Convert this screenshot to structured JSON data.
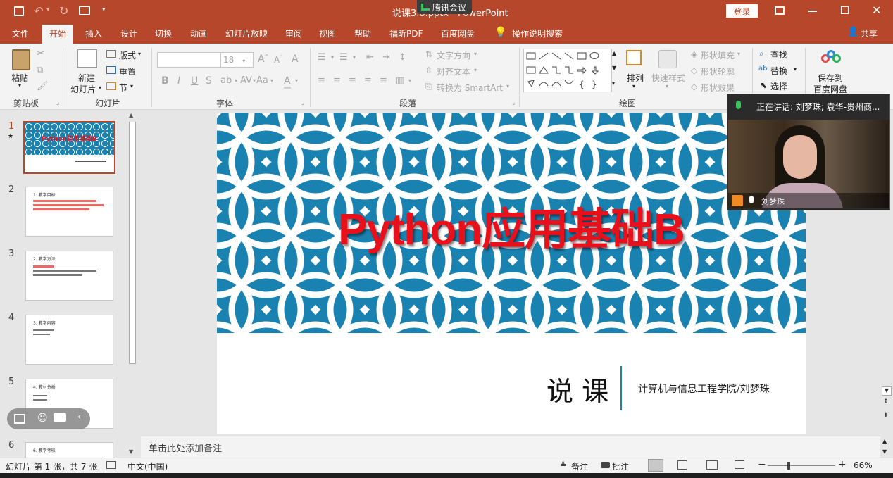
{
  "titlebar": {
    "title": "说课3.8.pptx - PowerPoint",
    "meeting_label": "腾讯会议",
    "login": "登录"
  },
  "tabs": [
    "文件",
    "开始",
    "插入",
    "设计",
    "切换",
    "动画",
    "幻灯片放映",
    "审阅",
    "视图",
    "帮助",
    "福昕PDF",
    "百度网盘"
  ],
  "tell_me": "操作说明搜索",
  "share": "共享",
  "ribbon": {
    "clipboard": {
      "paste": "粘贴",
      "label": "剪贴板"
    },
    "slides": {
      "new_slide": "新建",
      "new_slide2": "幻灯片",
      "layout": "版式",
      "reset": "重置",
      "section": "节",
      "label": "幻灯片"
    },
    "font": {
      "size": "18",
      "label": "字体"
    },
    "paragraph": {
      "text_direction": "文字方向",
      "align_text": "对齐文本",
      "convert_smartart": "转换为 SmartArt",
      "label": "段落"
    },
    "drawing": {
      "arrange": "排列",
      "quick_styles": "快速样式",
      "shape_fill": "形状填充",
      "shape_outline": "形状轮廓",
      "shape_effects": "形状效果",
      "label": "绘图"
    },
    "editing": {
      "find": "查找",
      "replace": "替换",
      "select": "选择"
    },
    "baidu": {
      "save_to": "保存到",
      "baidu_disk": "百度网盘"
    }
  },
  "slide_numbers": [
    "1",
    "2",
    "3",
    "4",
    "5",
    "6"
  ],
  "thumb_titles": [
    "Python应用基础B",
    "1. 教学目标",
    "2. 教学方法",
    "3. 教学内容",
    "4. 教材分析",
    "6. 教学考核"
  ],
  "slide": {
    "title": "Python应用基础B",
    "subtitle": "说 课",
    "author": "计算机与信息工程学院/刘梦珠"
  },
  "notes_placeholder": "单击此处添加备注",
  "status": {
    "slide_info": "幻灯片 第 1 张，共 7 张",
    "language": "中文(中国)",
    "notes": "备注",
    "comments": "批注",
    "zoom": "66%"
  },
  "meeting": {
    "speaking": "正在讲话: 刘梦珠; 袁华-贵州商...",
    "participant": "刘梦珠"
  },
  "colors": {
    "accent": "#b7472a",
    "slide_pattern_bg": "#1a82b0",
    "title_red": "#e8101a"
  }
}
